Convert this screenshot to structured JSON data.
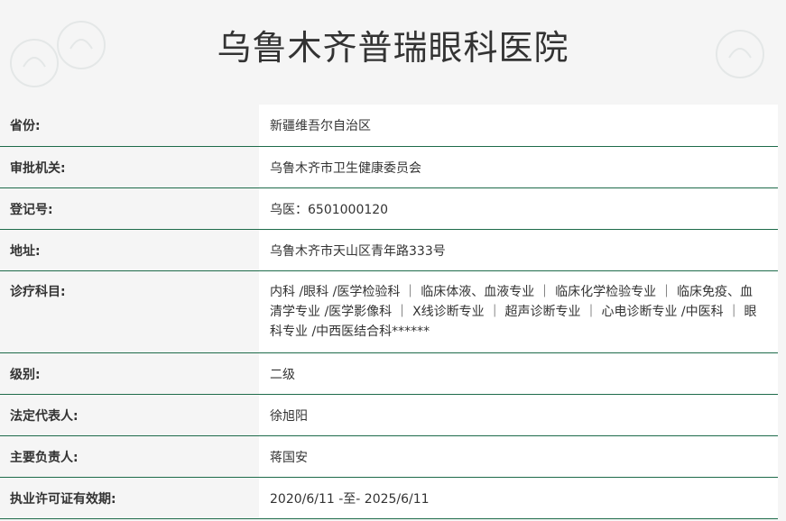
{
  "title": "乌鲁木齐普瑞眼科医院",
  "colors": {
    "border": "#1e6b4a",
    "label_bg": "#f5f5f5",
    "value_bg": "#ffffff",
    "text": "#333333"
  },
  "rows": [
    {
      "label": "省份:",
      "value": "新疆维吾尔自治区"
    },
    {
      "label": "审批机关:",
      "value": "乌鲁木齐市卫生健康委员会"
    },
    {
      "label": "登记号:",
      "value": "乌医：6501000120"
    },
    {
      "label": "地址:",
      "value": "乌鲁木齐市天山区青年路333号"
    },
    {
      "label": "诊疗科目:",
      "value": "内科 /眼科 /医学检验科 ｜ 临床体液、血液专业 ｜ 临床化学检验专业 ｜ 临床免疫、血清学专业 /医学影像科 ｜ X线诊断专业 ｜ 超声诊断专业 ｜ 心电诊断专业 /中医科 ｜ 眼科专业 /中西医结合科******"
    },
    {
      "label": "级别:",
      "value": "二级"
    },
    {
      "label": "法定代表人:",
      "value": "徐旭阳"
    },
    {
      "label": "主要负责人:",
      "value": "蒋国安"
    },
    {
      "label": "执业许可证有效期:",
      "value": "2020/6/11 -至- 2025/6/11"
    }
  ]
}
